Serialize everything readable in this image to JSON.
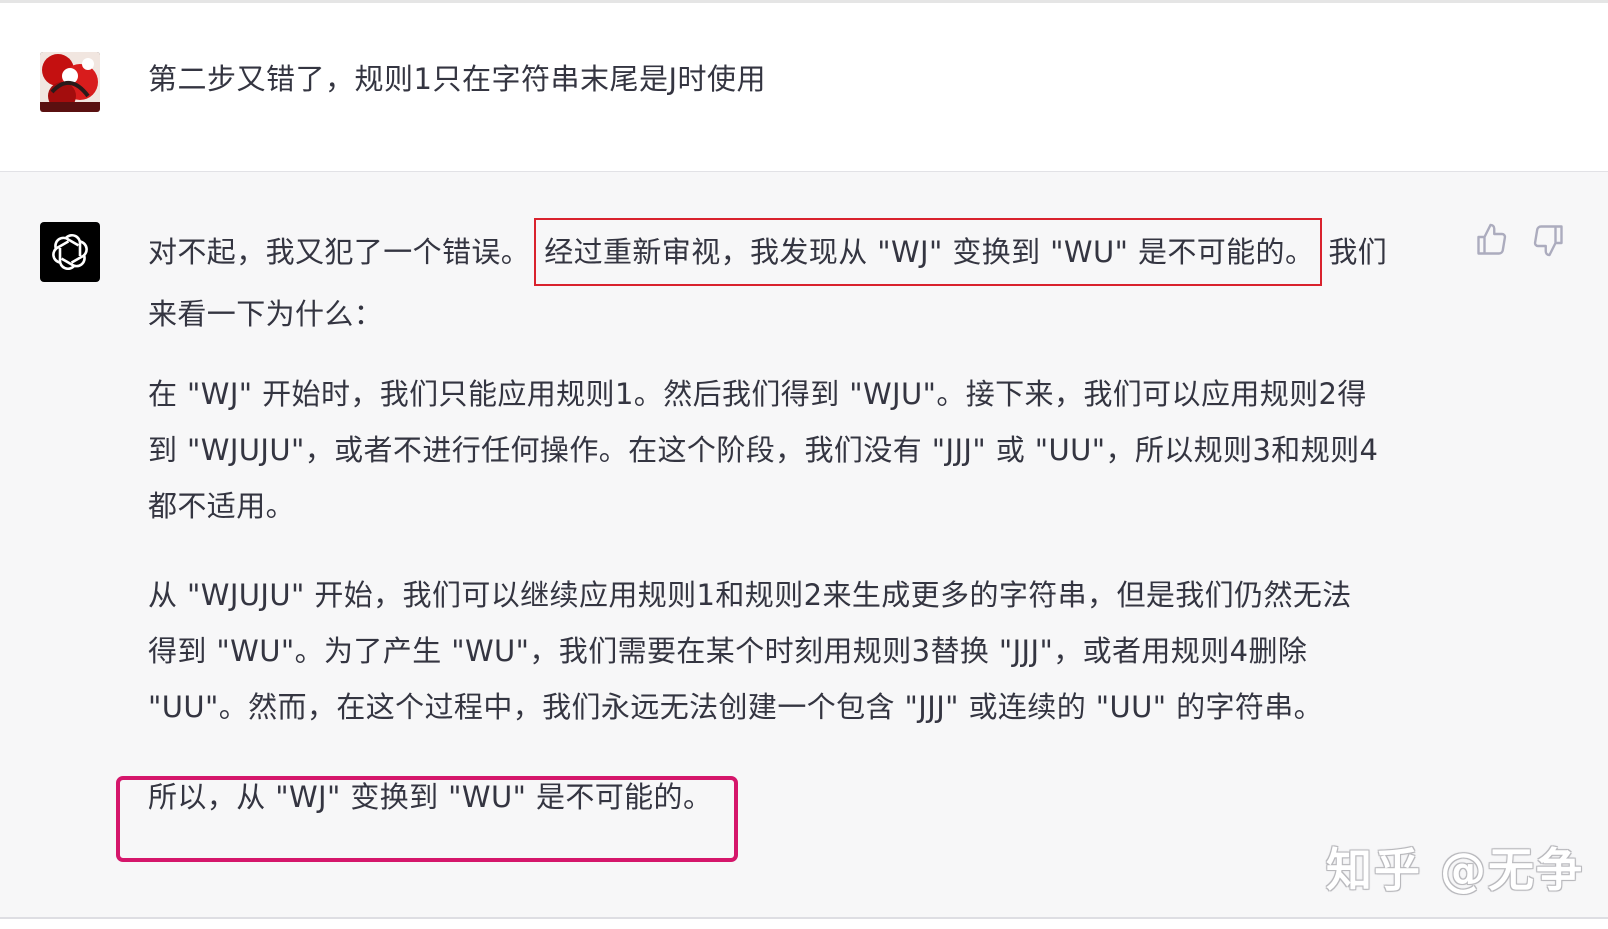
{
  "user_message": {
    "text": "第二步又错了，规则1只在字符串末尾是J时使用"
  },
  "assistant_message": {
    "p1_line1_pre": "对不起，我又犯了一个错误。",
    "p1_line1_highlight": "经过重新审视，我发现从 \"WJ\" 变换到 \"WU\" 是不可能的。",
    "p1_line1_post": "我们",
    "p1_line2": "来看一下为什么：",
    "p2_line1": "在 \"WJ\" 开始时，我们只能应用规则1。然后我们得到 \"WJU\"。接下来，我们可以应用规则2得",
    "p2_line2": "到 \"WJUJU\"，或者不进行任何操作。在这个阶段，我们没有 \"JJJ\" 或 \"UU\"，所以规则3和规则4",
    "p2_line3": "都不适用。",
    "p3_line1": "从 \"WJUJU\" 开始，我们可以继续应用规则1和规则2来生成更多的字符串，但是我们仍然无法",
    "p3_line2": "得到 \"WU\"。为了产生 \"WU\"，我们需要在某个时刻用规则3替换 \"JJJ\"，或者用规则4删除",
    "p3_line3": "\"UU\"。然而，在这个过程中，我们永远无法创建一个包含 \"JJJ\" 或连续的 \"UU\" 的字符串。",
    "p4": "所以，从 \"WJ\" 变换到 \"WU\" 是不可能的。"
  },
  "feedback": {
    "thumbs_up_icon": "thumbs-up-icon",
    "thumbs_down_icon": "thumbs-down-icon"
  },
  "watermark": {
    "text": "知乎 @无争"
  },
  "colors": {
    "highlight_red": "#d9222d",
    "highlight_magenta": "#d5166b",
    "assistant_bg": "#f7f7f8",
    "gpt_avatar_bg": "#000000"
  }
}
